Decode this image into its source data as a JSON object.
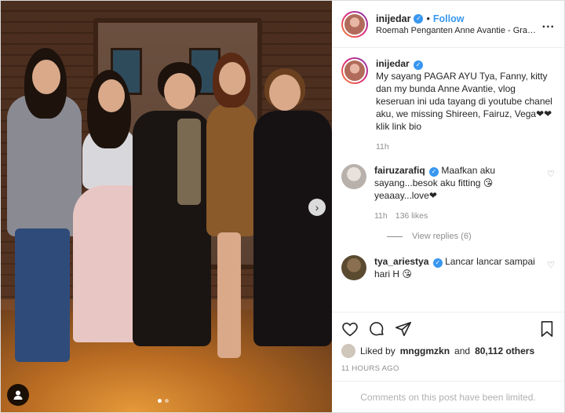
{
  "header": {
    "username": "inijedar",
    "separator": "•",
    "follow_label": "Follow",
    "location": "Roemah Penganten Anne Avantie - Grand Ind...",
    "more": "..."
  },
  "caption": {
    "username": "inijedar",
    "text": "My sayang PAGAR AYU Tya, Fanny, kitty dan my bunda Anne Avantie, vlog keseruan ini uda tayang di youtube chanel aku, we missing Shireen, Fairuz, Vega❤❤ klik link bio",
    "time": "11h"
  },
  "comments": [
    {
      "username": "fairuzarafiq",
      "text": "Maafkan aku sayang...besok aku fitting 😘 yeaaay...love❤",
      "time": "11h",
      "likes": "136 likes",
      "view_replies": "View replies (6)"
    },
    {
      "username": "tya_ariestya",
      "text": "Lancar lancar sampai hari H 😘"
    }
  ],
  "likes": {
    "prefix": "Liked by",
    "user": "mnggmzkn",
    "and": "and",
    "count": "80,112 others"
  },
  "timestamp": "11 HOURS AGO",
  "comments_limited": "Comments on this post have been limited.",
  "colors": {
    "accent": "#3897f0",
    "muted": "#8e8e8e",
    "heart": "#ed4956"
  },
  "icons": [
    "heart-icon",
    "comment-icon",
    "share-icon",
    "bookmark-icon",
    "verified-icon",
    "next-arrow-icon",
    "user-tag-icon"
  ]
}
